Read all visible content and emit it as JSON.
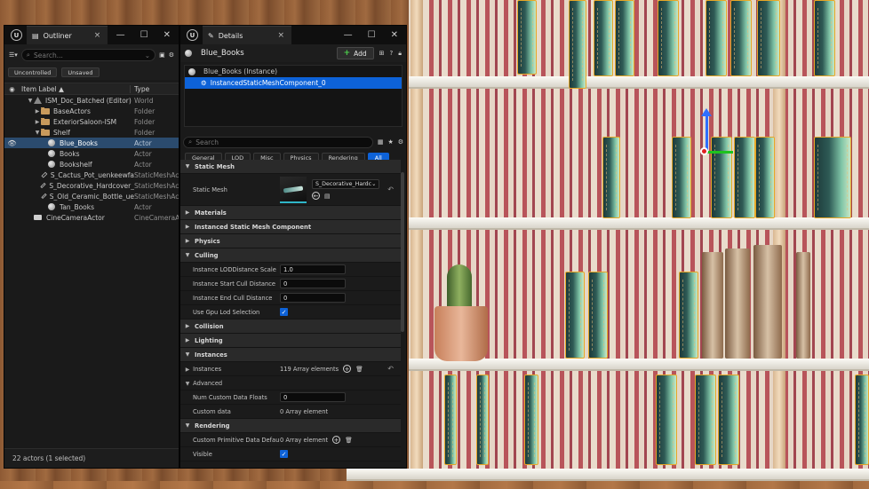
{
  "outliner": {
    "tab_label": "Outliner",
    "close_glyph": "×",
    "window_buttons": [
      "—",
      "☐",
      "✕"
    ],
    "search_placeholder": "Search...",
    "filter_chips": [
      "Uncontrolled",
      "Unsaved"
    ],
    "col_item_label": "Item Label ▲",
    "col_type": "Type",
    "rows": [
      {
        "name": "ISM_Doc_Batched (Editor)",
        "type": "World",
        "icon": "world-icon",
        "indent": 1,
        "arrow": "▼",
        "eye": "",
        "selected": false
      },
      {
        "name": "BaseActors",
        "type": "Folder",
        "icon": "folder-icon",
        "indent": 2,
        "arrow": "▶",
        "eye": "",
        "selected": false
      },
      {
        "name": "ExteriorSaloon-ISM",
        "type": "Folder",
        "icon": "folder-icon",
        "indent": 2,
        "arrow": "▶",
        "eye": "",
        "selected": false
      },
      {
        "name": "Shelf",
        "type": "Folder",
        "icon": "folder-open-icon",
        "indent": 2,
        "arrow": "▼",
        "eye": "",
        "selected": false
      },
      {
        "name": "Blue_Books",
        "type": "Actor",
        "icon": "actor-icon",
        "indent": 3,
        "arrow": "",
        "eye": "👁",
        "selected": true
      },
      {
        "name": "Books",
        "type": "Actor",
        "icon": "actor-icon",
        "indent": 3,
        "arrow": "",
        "eye": "",
        "selected": false
      },
      {
        "name": "Bookshelf",
        "type": "Actor",
        "icon": "actor-icon",
        "indent": 3,
        "arrow": "",
        "eye": "",
        "selected": false
      },
      {
        "name": "S_Cactus_Pot_uenkeewfa",
        "type": "StaticMeshActor",
        "icon": "static-mesh-icon",
        "indent": 3,
        "arrow": "",
        "eye": "",
        "selected": false
      },
      {
        "name": "S_Decorative_Hardcover_",
        "type": "StaticMeshActor",
        "icon": "static-mesh-icon",
        "indent": 3,
        "arrow": "",
        "eye": "",
        "selected": false
      },
      {
        "name": "S_Old_Ceramic_Bottle_ue",
        "type": "StaticMeshActor",
        "icon": "static-mesh-icon",
        "indent": 3,
        "arrow": "",
        "eye": "",
        "selected": false
      },
      {
        "name": "Tan_Books",
        "type": "Actor",
        "icon": "actor-icon",
        "indent": 3,
        "arrow": "",
        "eye": "",
        "selected": false
      },
      {
        "name": "CineCameraActor",
        "type": "CineCameraActor",
        "icon": "camera-icon",
        "indent": 1,
        "arrow": "",
        "eye": "",
        "selected": false
      }
    ],
    "footer": "22 actors (1 selected)"
  },
  "details": {
    "tab_label": "Details",
    "close_glyph": "×",
    "window_buttons": [
      "—",
      "☐",
      "✕"
    ],
    "actor_name": "Blue_Books",
    "add_label": "Add",
    "hierarchy": [
      {
        "label": "Blue_Books (Instance)",
        "selected": false
      },
      {
        "label": "InstancedStaticMeshComponent_0",
        "selected": true
      }
    ],
    "search_placeholder": "Search",
    "filter_tabs": [
      {
        "label": "General",
        "active": false
      },
      {
        "label": "LOD",
        "active": false
      },
      {
        "label": "Misc",
        "active": false
      },
      {
        "label": "Physics",
        "active": false
      },
      {
        "label": "Rendering",
        "active": false
      },
      {
        "label": "All",
        "active": true
      }
    ],
    "static_mesh_cat": "Static Mesh",
    "static_mesh_label": "Static Mesh",
    "static_mesh_value": "S_Decorative_Hardc",
    "cat_materials": "Materials",
    "cat_ism": "Instanced Static Mesh Component",
    "cat_physics": "Physics",
    "cat_culling": "Culling",
    "lod_scale_label": "Instance LODDistance Scale",
    "lod_scale_value": "1.0",
    "start_cull_label": "Instance Start Cull Distance",
    "start_cull_value": "0",
    "end_cull_label": "Instance End Cull Distance",
    "end_cull_value": "0",
    "gpu_lod_label": "Use Gpu Lod Selection",
    "cat_collision": "Collision",
    "cat_lighting": "Lighting",
    "cat_instances": "Instances",
    "instances_label": "Instances",
    "instances_value": "119 Array elements",
    "cat_advanced": "Advanced",
    "num_custom_label": "Num Custom Data Floats",
    "num_custom_value": "0",
    "custom_data_label": "Custom data",
    "custom_data_value": "0 Array element",
    "cat_rendering": "Rendering",
    "cpd_label": "Custom Primitive Data Defaults",
    "cpd_value": "0 Array element",
    "visible_label": "Visible"
  }
}
